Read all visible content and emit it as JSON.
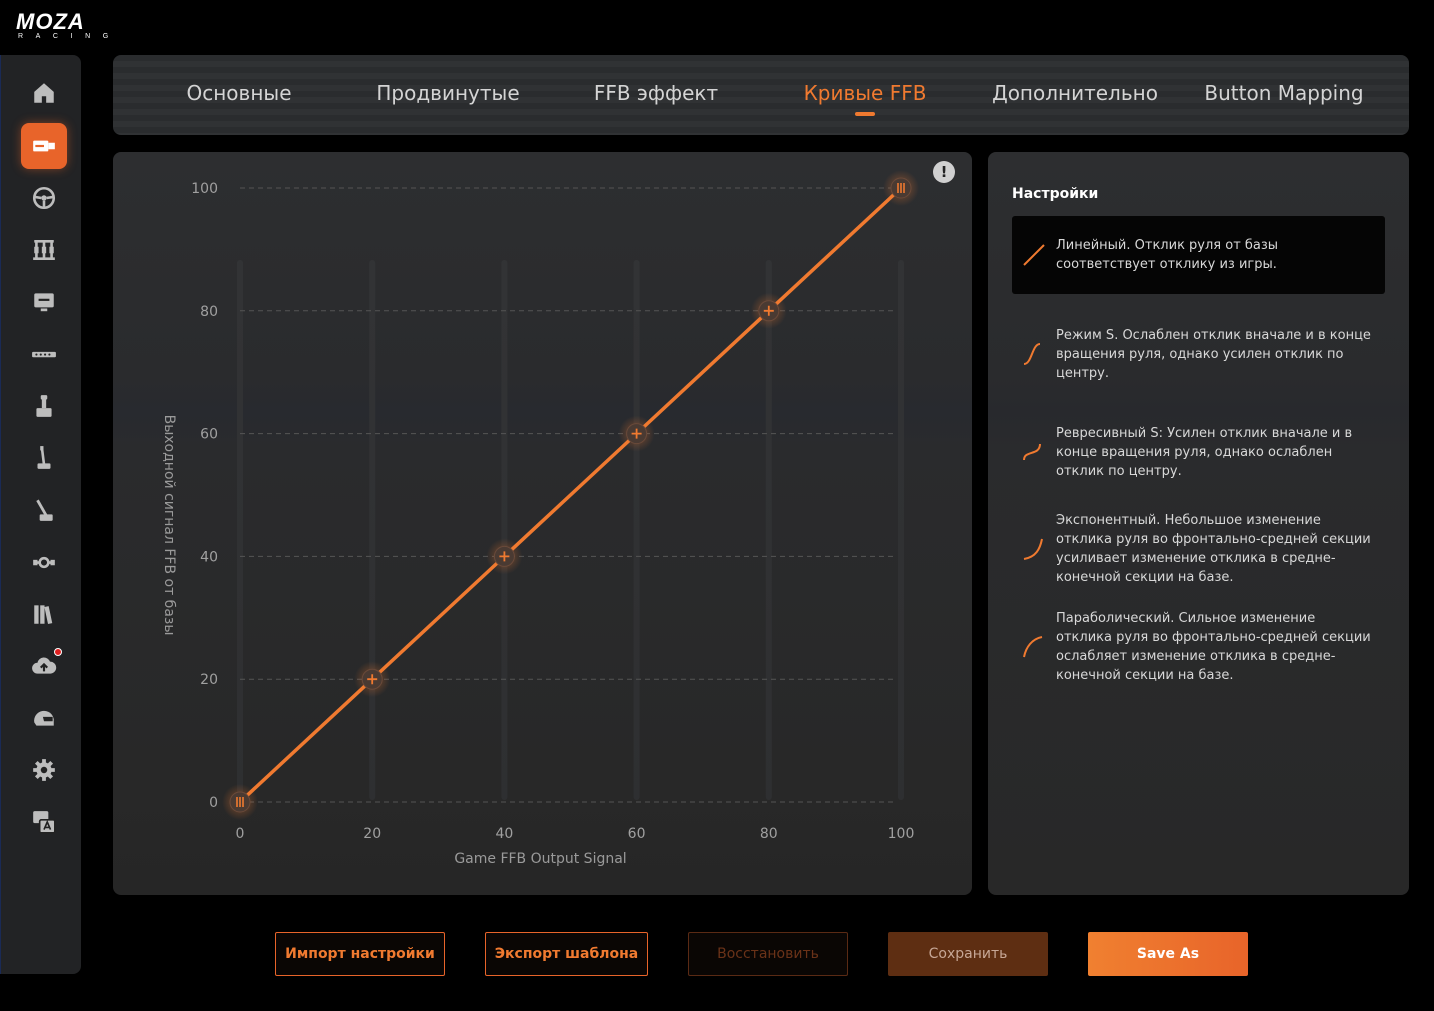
{
  "brand": {
    "name": "MOZA",
    "sub": "RACING"
  },
  "sidebar": {
    "items": [
      {
        "name": "home-icon",
        "active": false
      },
      {
        "name": "wheelbase-icon",
        "active": true
      },
      {
        "name": "steering-wheel-icon",
        "active": false
      },
      {
        "name": "pedals-icon",
        "active": false
      },
      {
        "name": "dashboard-display-icon",
        "active": false
      },
      {
        "name": "led-bar-icon",
        "active": false
      },
      {
        "name": "joystick-icon",
        "active": false
      },
      {
        "name": "handbrake-icon",
        "active": false
      },
      {
        "name": "shifter-icon",
        "active": false
      },
      {
        "name": "hub-icon",
        "active": false
      },
      {
        "name": "library-icon",
        "active": false
      },
      {
        "name": "cloud-update-icon",
        "active": false,
        "badge": true
      },
      {
        "name": "helmet-icon",
        "active": false
      },
      {
        "name": "settings-gear-icon",
        "active": false
      },
      {
        "name": "language-icon",
        "active": false
      }
    ]
  },
  "tabs": [
    {
      "label": "Основные"
    },
    {
      "label": "Продвинутые"
    },
    {
      "label": "FFB эффект"
    },
    {
      "label": "Кривые FFB",
      "active": true
    },
    {
      "label": "Дополнительно"
    },
    {
      "label": "Button Mapping"
    }
  ],
  "chart_data": {
    "type": "line",
    "x": [
      0,
      20,
      40,
      60,
      80,
      100
    ],
    "series": [
      {
        "values": [
          0,
          20,
          40,
          60,
          80,
          100
        ]
      }
    ],
    "xlabel": "Game FFB Output Signal",
    "ylabel": "Выходной сигнал FFB от базы",
    "xlim": [
      0,
      100
    ],
    "ylim": [
      0,
      100
    ],
    "xticks": [
      0,
      20,
      40,
      60,
      80,
      100
    ],
    "yticks": [
      0,
      20,
      40,
      60,
      80,
      100
    ],
    "grid": true,
    "line_color": "#f07a30"
  },
  "settings": {
    "title": "Настройки",
    "presets": [
      {
        "label": "Линейный. Отклик руля от базы соответствует отклику из игры.",
        "curve": "linear",
        "selected": true
      },
      {
        "label": "Режим S. Ослаблен отклик вначале и в конце вращения руля, однако усилен отклик по центру.",
        "curve": "s"
      },
      {
        "label": "Ревресивный S: Усилен отклик вначале и в конце вращения руля, однако ослаблен отклик по центру.",
        "curve": "reverse-s"
      },
      {
        "label": "Экспонентный. Небольшое изменение отклика руля во фронтально-средней секции усиливает изменение отклика в средне-конечной секции на базе.",
        "curve": "exponential"
      },
      {
        "label": "Параболический. Сильное изменение отклика руля во фронтально-средней секции ослабляет изменение отклика в средне-конечной секции на базе.",
        "curve": "parabolic"
      }
    ]
  },
  "buttons": {
    "import": "Импорт настройки",
    "export": "Экспорт шаблона",
    "restore": "Восстановить",
    "save": "Сохранить",
    "save_as": "Save As"
  },
  "colors": {
    "accent": "#f07a30",
    "accent_dark": "#e8642a",
    "background": "#000000",
    "panel": "#2a2b2d"
  }
}
